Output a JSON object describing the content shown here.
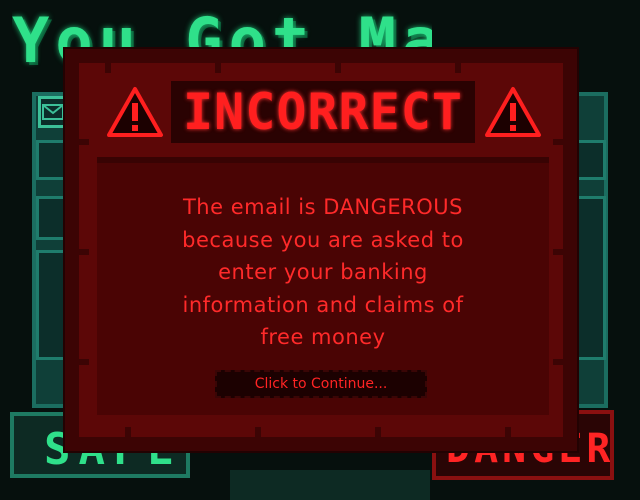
{
  "background": {
    "title": "You Got Mail",
    "safe_label": "SAFE",
    "danger_label": "DANGER!"
  },
  "modal": {
    "title": "INCORRECT",
    "message": "The email is DANGEROUS\nbecause you are asked to\nenter your banking\ninformation and claims of\nfree money",
    "continue_label": "Click to Continue...",
    "left_icon": "warning-triangle-icon",
    "right_icon": "warning-triangle-icon"
  },
  "colors": {
    "modal_bg": "#5c0707",
    "modal_text": "#ff2424",
    "game_green": "#2fe08a",
    "panel_teal": "#0f3f38"
  }
}
